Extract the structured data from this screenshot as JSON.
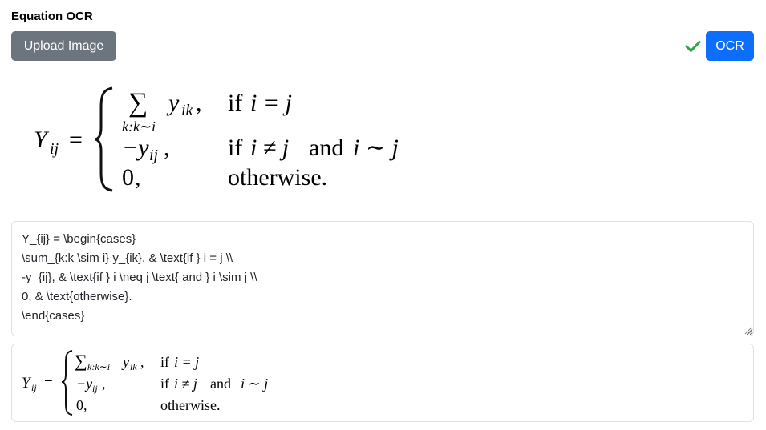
{
  "app": {
    "title": "Equation OCR"
  },
  "toolbar": {
    "upload_label": "Upload Image",
    "ocr_label": "OCR",
    "status_icon": "check-icon",
    "status_color": "#28a745"
  },
  "colors": {
    "upload_bg": "#6c757d",
    "ocr_bg": "#0d6efd",
    "border": "#dee2e6"
  },
  "source_image": {
    "lhs": "Y",
    "lhs_sub": "ij",
    "equals": "=",
    "rows": [
      {
        "expr_sym": "∑",
        "expr_under": "k:k∼i",
        "expr": "y",
        "expr_sub": "ik",
        "punct": ",",
        "cond_text": "if",
        "cond_math": "i = j"
      },
      {
        "expr": "−y",
        "expr_sub": "ij",
        "punct": ",",
        "cond_text": "if",
        "cond_math": "i ≠ j",
        "cond_and": "and",
        "cond_math2": "i ∼ j"
      },
      {
        "expr": "0",
        "punct": ",",
        "cond_text": "otherwise."
      }
    ]
  },
  "latex_output": {
    "value": "Y_{ij} = \\begin{cases}\n\\sum_{k:k \\sim i} y_{ik}, & \\text{if } i = j \\\\\n-y_{ij}, & \\text{if } i \\neq j \\text{ and } i \\sim j \\\\\n0, & \\text{otherwise}.\n\\end{cases}"
  },
  "rendered": {
    "lhs": "Y",
    "lhs_sub": "ij",
    "equals": "=",
    "row1_sym": "∑",
    "row1_sub": "k:k∼i",
    "row1_expr": "y",
    "row1_expr_sub": "ik",
    "row1_punct": ",",
    "row1_cond": "if",
    "row1_cond_math": "i = j",
    "row2_expr": "−y",
    "row2_expr_sub": "ij",
    "row2_punct": ",",
    "row2_cond": "if",
    "row2_cond_math": "i ≠ j",
    "row2_and": "and",
    "row2_cond_math2": "i ∼ j",
    "row3_expr": "0,",
    "row3_cond": "otherwise."
  }
}
